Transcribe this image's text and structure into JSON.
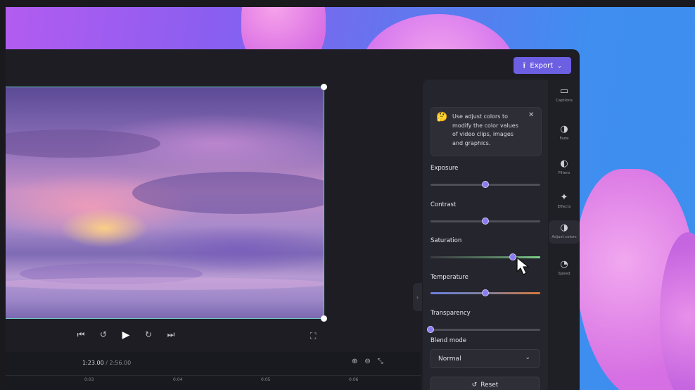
{
  "header": {
    "export_label": "Export"
  },
  "player": {
    "current_time": "1:23.00",
    "total_time": "2:56.00"
  },
  "timeline": {
    "ruler_ticks": [
      "0:03",
      "0:04",
      "0:05",
      "0:06"
    ]
  },
  "panel": {
    "tip_text": "Use adjust colors to modify the color values of video clips, images and graphics.",
    "sliders": [
      {
        "label": "Exposure",
        "value": 0.5
      },
      {
        "label": "Contrast",
        "value": 0.5
      },
      {
        "label": "Saturation",
        "value": 0.75
      },
      {
        "label": "Temperature",
        "value": 0.5
      },
      {
        "label": "Transparency",
        "value": 0.0
      }
    ],
    "blend_mode_label": "Blend mode",
    "blend_mode_value": "Normal",
    "reset_label": "Reset"
  },
  "rail": {
    "items": [
      {
        "label": "Captions",
        "icon": "captions-icon"
      },
      {
        "label": "Fade",
        "icon": "fade-icon"
      },
      {
        "label": "Filters",
        "icon": "filters-icon"
      },
      {
        "label": "Effects",
        "icon": "effects-icon"
      },
      {
        "label": "Adjust colors",
        "icon": "adjust-colors-icon",
        "active": true
      },
      {
        "label": "Speed",
        "icon": "speed-icon"
      }
    ]
  },
  "colors": {
    "accent": "#6c5fe2",
    "selection": "#6fc8c4",
    "temperature_cool": "#6b7fe0",
    "temperature_warm": "#d7773d"
  }
}
